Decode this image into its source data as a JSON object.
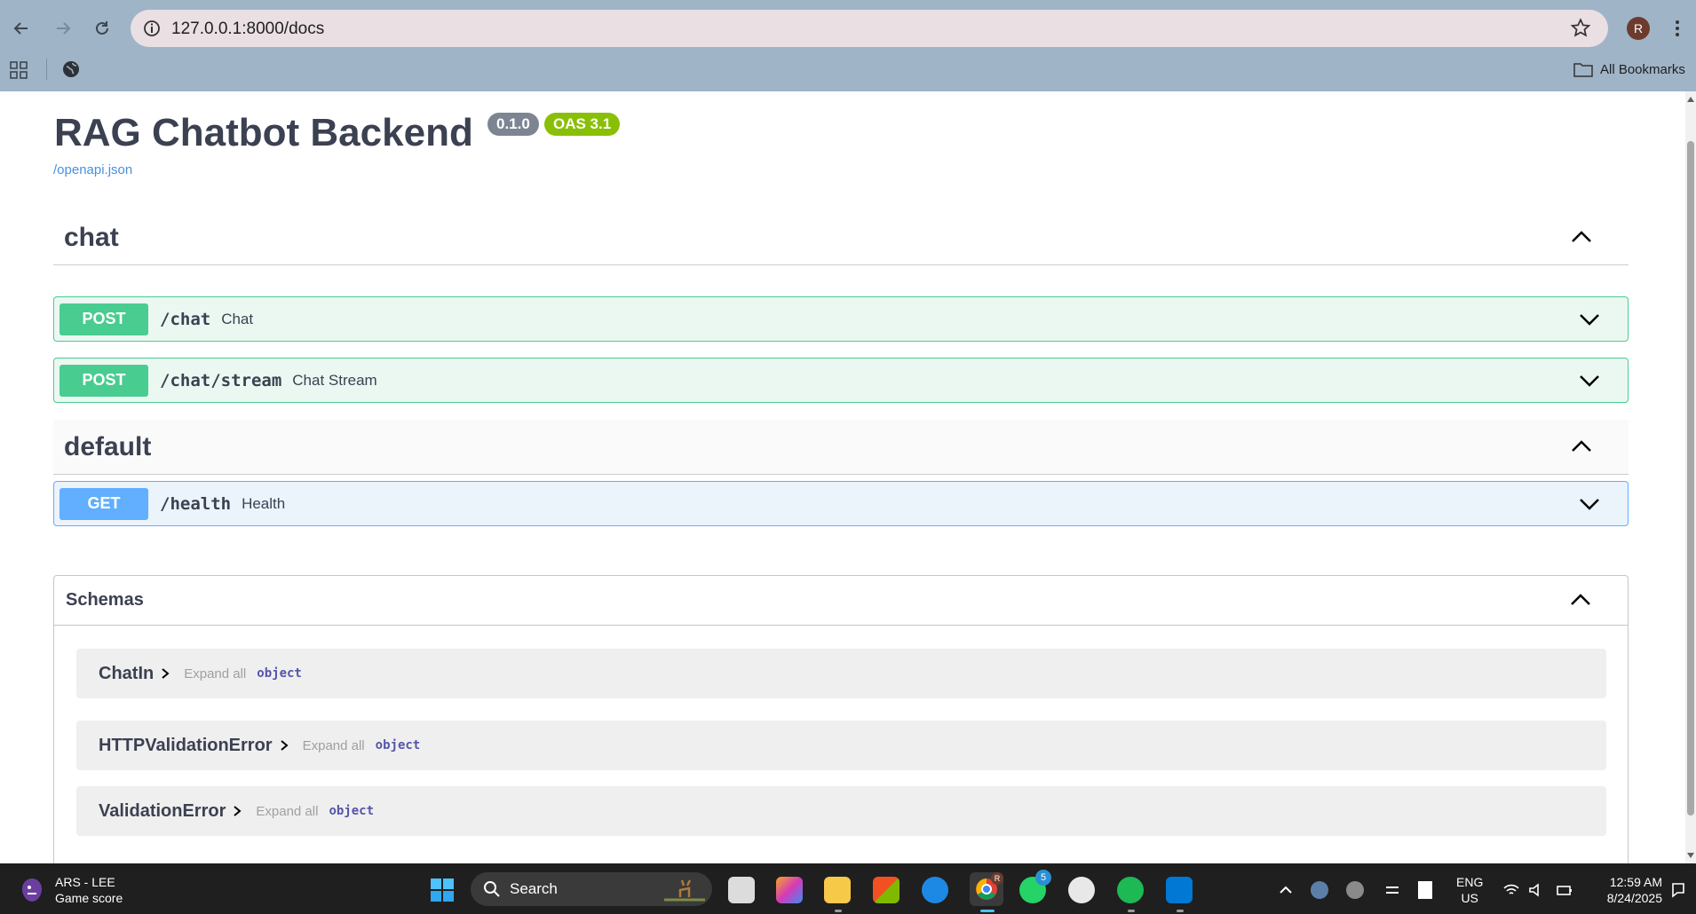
{
  "browser": {
    "url": "127.0.0.1:8000/docs",
    "profile_initial": "R",
    "all_bookmarks_label": "All Bookmarks"
  },
  "api": {
    "title": "RAG Chatbot Backend",
    "version_badge": "0.1.0",
    "oas_badge": "OAS 3.1",
    "openapi_link": "/openapi.json"
  },
  "tags": [
    {
      "name": "chat",
      "operations": [
        {
          "method": "POST",
          "path": "/chat",
          "summary": "Chat"
        },
        {
          "method": "POST",
          "path": "/chat/stream",
          "summary": "Chat Stream"
        }
      ]
    },
    {
      "name": "default",
      "operations": [
        {
          "method": "GET",
          "path": "/health",
          "summary": "Health"
        }
      ]
    }
  ],
  "schemas": {
    "title": "Schemas",
    "models": [
      {
        "name": "ChatIn",
        "expand_label": "Expand all",
        "type": "object"
      },
      {
        "name": "HTTPValidationError",
        "expand_label": "Expand all",
        "type": "object"
      },
      {
        "name": "ValidationError",
        "expand_label": "Expand all",
        "type": "object"
      }
    ]
  },
  "taskbar": {
    "widget_title": "ARS - LEE",
    "widget_subtitle": "Game score",
    "search_placeholder": "Search",
    "whatsapp_badge": "5",
    "chrome_badge": "R",
    "language_line1": "ENG",
    "language_line2": "US",
    "time": "12:59 AM",
    "date": "8/24/2025"
  },
  "colors": {
    "post": "#49cc90",
    "get": "#61affe",
    "link": "#4990e2",
    "oas_badge": "#89bf04",
    "version_badge": "#7d8492"
  }
}
